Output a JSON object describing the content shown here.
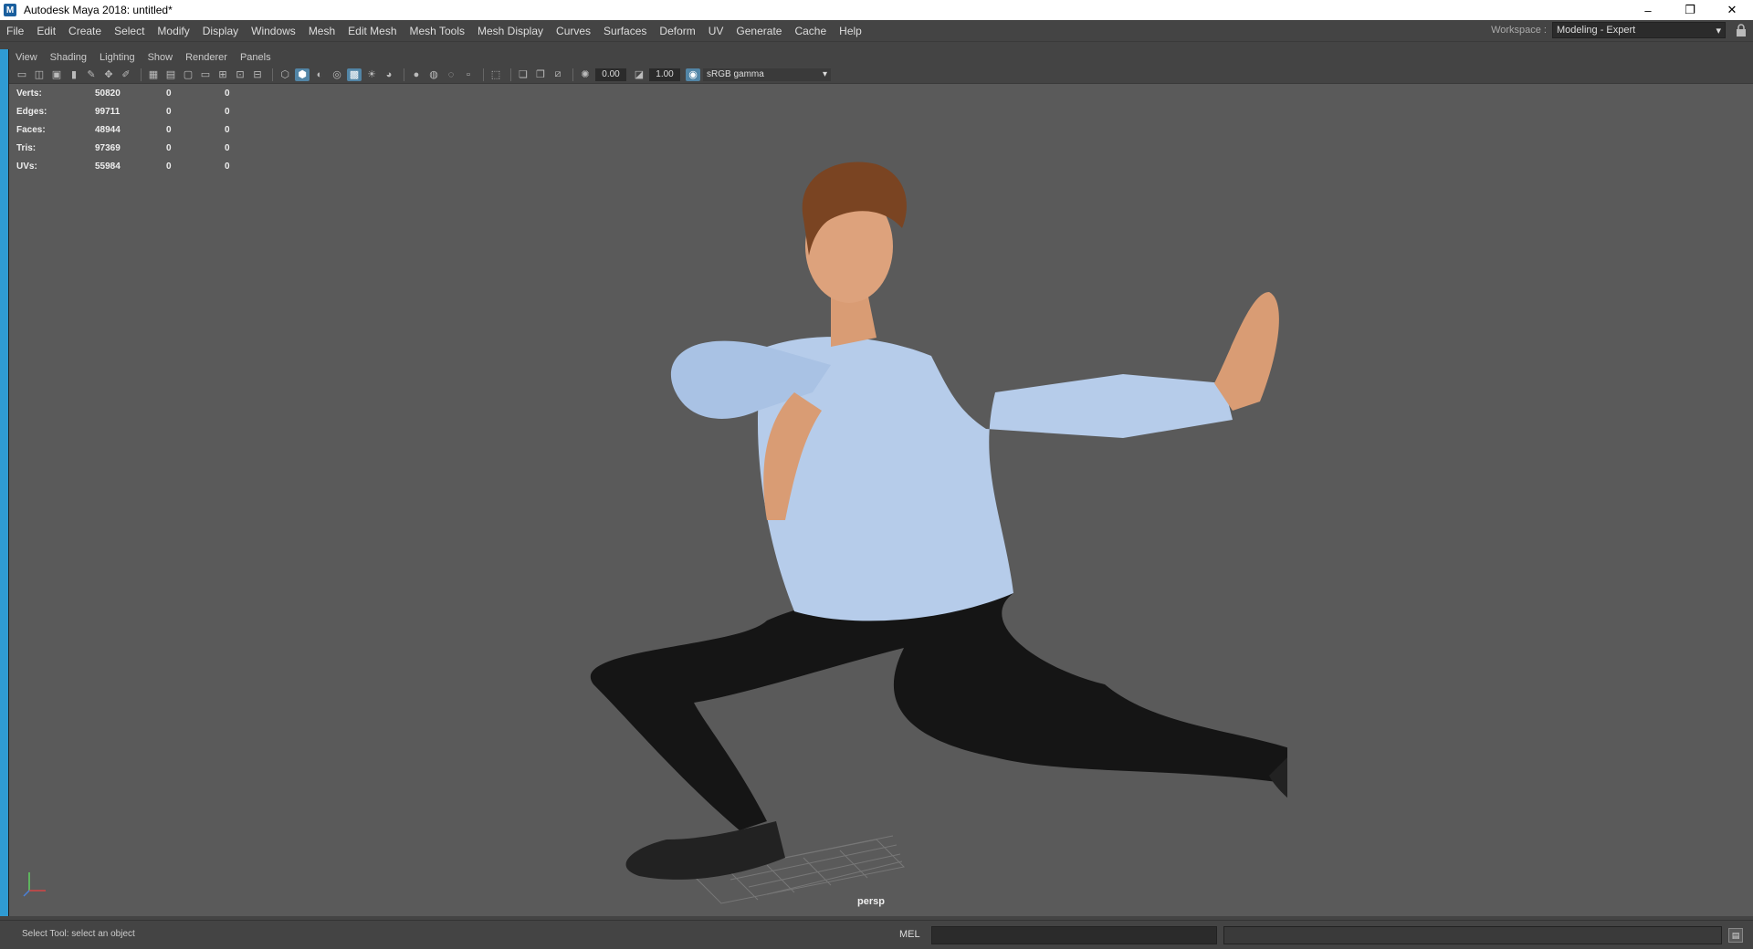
{
  "window": {
    "app_icon": "M",
    "title": "Autodesk Maya 2018: untitled*",
    "minimize": "–",
    "maximize": "❐",
    "close": "✕"
  },
  "main_menu": [
    "File",
    "Edit",
    "Create",
    "Select",
    "Modify",
    "Display",
    "Windows",
    "Mesh",
    "Edit Mesh",
    "Mesh Tools",
    "Mesh Display",
    "Curves",
    "Surfaces",
    "Deform",
    "UV",
    "Generate",
    "Cache",
    "Help"
  ],
  "workspace": {
    "label": "Workspace :",
    "value": "Modeling - Expert",
    "lock_icon": "lock-icon"
  },
  "panel_menu": [
    "View",
    "Shading",
    "Lighting",
    "Show",
    "Renderer",
    "Panels"
  ],
  "panel_toolbar": {
    "exposure": "0.00",
    "gamma": "1.00",
    "color_space": "sRGB gamma"
  },
  "hud": {
    "rows": [
      {
        "label": "Verts:",
        "v1": "50820",
        "v2": "0",
        "v3": "0"
      },
      {
        "label": "Edges:",
        "v1": "99711",
        "v2": "0",
        "v3": "0"
      },
      {
        "label": "Faces:",
        "v1": "48944",
        "v2": "0",
        "v3": "0"
      },
      {
        "label": "Tris:",
        "v1": "97369",
        "v2": "0",
        "v3": "0"
      },
      {
        "label": "UVs:",
        "v1": "55984",
        "v2": "0",
        "v3": "0"
      }
    ]
  },
  "viewport": {
    "camera": "persp"
  },
  "status": {
    "help_line": "Select Tool: select an object",
    "mel_label": "MEL"
  },
  "colors": {
    "accent": "#2f9bd3",
    "viewport_bg": "#5a5a5a",
    "ui_bg": "#444444",
    "toolbar_active": "#5285a6"
  }
}
